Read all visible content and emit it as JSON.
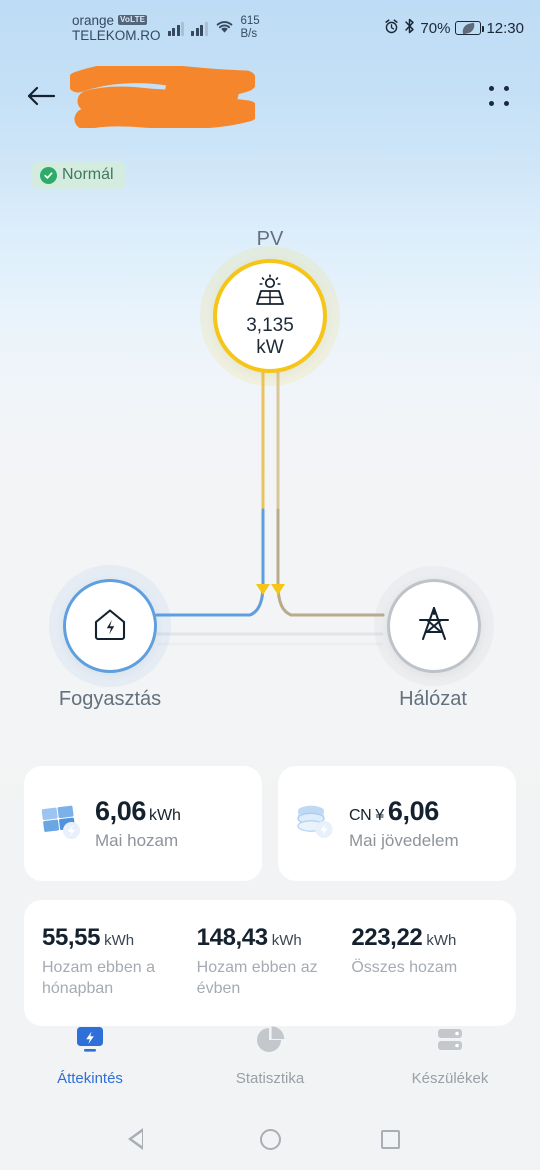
{
  "statusbar": {
    "carrier_line1": "orange",
    "volte_badge": "VoLTE",
    "carrier_line2": "TELEKOM.RO",
    "netspeed_value": "615",
    "netspeed_unit": "B/s",
    "battery_percent": "70%",
    "clock": "12:30",
    "icons": [
      "alarm-icon",
      "bluetooth-icon",
      "battery-saver-icon"
    ]
  },
  "appbar": {
    "back_icon": "back-arrow-icon",
    "menu_icon": "grid-dots-menu-icon",
    "title_redacted": true
  },
  "scrolled_row": {
    "left_partial": "",
    "right_partial": ""
  },
  "status": {
    "label": "Normál",
    "badge_color": "#2eab68",
    "pill_bg": "#d4ece0"
  },
  "flow": {
    "pv": {
      "label": "PV",
      "value": "3,135",
      "unit": "kW",
      "ring_color": "#f5c518",
      "icon": "solar-panel-icon"
    },
    "home": {
      "label": "Fogyasztás",
      "ring_color": "#5f9fe0",
      "icon": "house-bolt-icon"
    },
    "grid": {
      "label": "Hálózat",
      "ring_color": "#bdc3c9",
      "icon": "power-pylon-icon"
    },
    "line_colors": {
      "pv_to_junction": "#e8c35e",
      "junction_to_home": "#5f9fe0",
      "junction_to_grid": "#b9ab8d",
      "idle": "#dcdfe3",
      "arrow": "#f5c518"
    }
  },
  "cards": [
    {
      "icon": "solar-panel-blue-icon",
      "currency": "",
      "value": "6,06",
      "unit": "kWh",
      "label": "Mai hozam"
    },
    {
      "icon": "coins-stack-icon",
      "currency": "CN ¥",
      "value": "6,06",
      "unit": "",
      "label": "Mai jövedelem"
    }
  ],
  "stats": [
    {
      "value": "55,55",
      "unit": "kWh",
      "label": "Hozam ebben a hónapban"
    },
    {
      "value": "148,43",
      "unit": "kWh",
      "label": "Hozam ebben az évben"
    },
    {
      "value": "223,22",
      "unit": "kWh",
      "label": "Összes hozam"
    }
  ],
  "tabs": [
    {
      "label": "Áttekintés",
      "icon": "overview-bolt-icon",
      "active": true
    },
    {
      "label": "Statisztika",
      "icon": "pie-chart-icon",
      "active": false
    },
    {
      "label": "Készülékek",
      "icon": "devices-stack-icon",
      "active": false
    }
  ],
  "navbar": {
    "back": "nav-back-icon",
    "home": "nav-home-icon",
    "recents": "nav-recents-icon"
  },
  "theme": {
    "accent_blue": "#2f6fd8",
    "pv_yellow": "#f5c518",
    "page_top": "#bedcf5",
    "page_bottom": "#f2f3f5",
    "redaction": "#f5862c"
  }
}
